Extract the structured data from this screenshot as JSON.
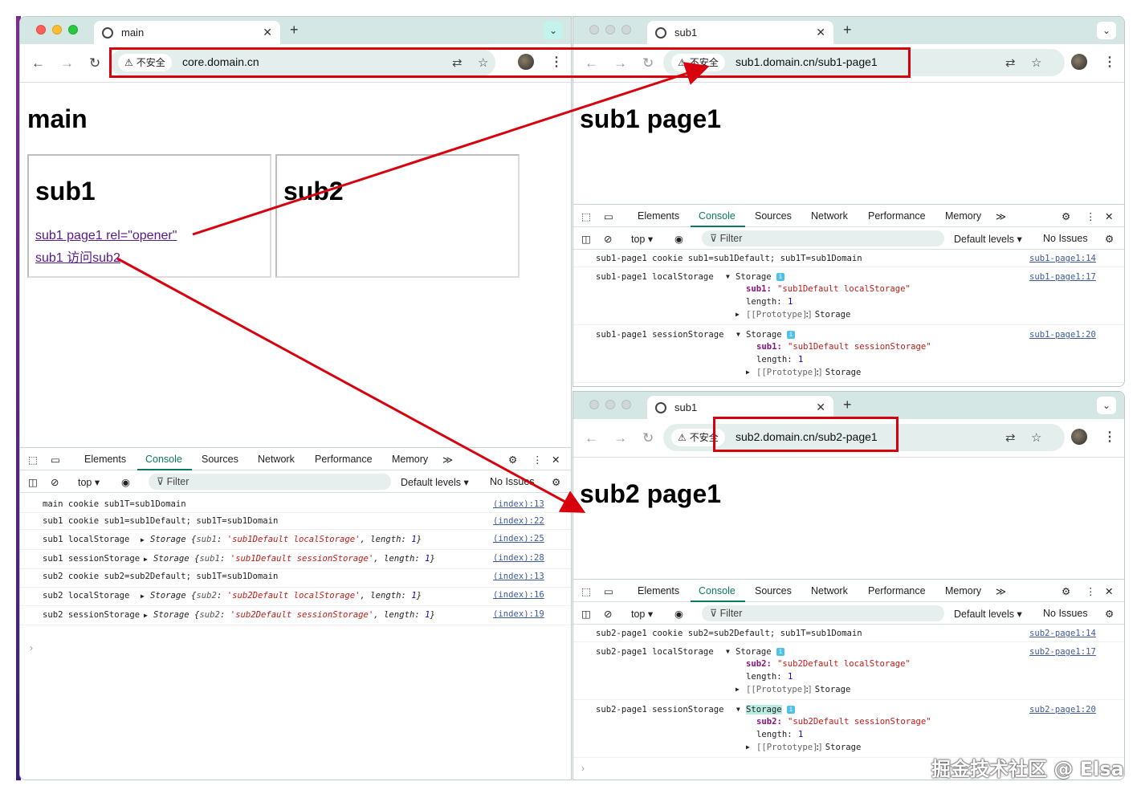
{
  "main": {
    "tab_title": "main",
    "insecure_label": "不安全",
    "url": "core.domain.cn",
    "heading": "main",
    "frame1": {
      "heading": "sub1",
      "link1": "sub1 page1 rel=\"opener\"",
      "link2": "sub1 访问sub2"
    },
    "frame2": {
      "heading": "sub2"
    },
    "devtools": {
      "tabs": [
        "Elements",
        "Console",
        "Sources",
        "Network",
        "Performance",
        "Memory"
      ],
      "context": "top",
      "filter": "Filter",
      "levels": "Default levels ▾",
      "issues": "No Issues",
      "logs": [
        {
          "msg": "main cookie sub1T=sub1Domain",
          "src": "(index):13"
        },
        {
          "msg": "sub1 cookie sub1=sub1Default; sub1T=sub1Domain",
          "src": "(index):22"
        },
        {
          "prefix": "sub1 localStorage",
          "obj": "Storage",
          "k": "sub1",
          "v": "'sub1Default localStorage'",
          "len": "1",
          "src": "(index):25"
        },
        {
          "prefix": "sub1 sessionStorage",
          "obj": "Storage",
          "k": "sub1",
          "v": "'sub1Default sessionStorage'",
          "len": "1",
          "src": "(index):28"
        },
        {
          "msg": "sub2 cookie sub2=sub2Default; sub1T=sub1Domain",
          "src": "(index):13"
        },
        {
          "prefix": "sub2 localStorage",
          "obj": "Storage",
          "k": "sub2",
          "v": "'sub2Default localStorage'",
          "len": "1",
          "src": "(index):16"
        },
        {
          "prefix": "sub2 sessionStorage",
          "obj": "Storage",
          "k": "sub2",
          "v": "'sub2Default sessionStorage'",
          "len": "1",
          "src": "(index):19"
        }
      ]
    }
  },
  "sub1": {
    "tab_title": "sub1",
    "insecure_label": "不安全",
    "url": "sub1.domain.cn/sub1-page1",
    "heading": "sub1 page1",
    "devtools": {
      "tabs": [
        "Elements",
        "Console",
        "Sources",
        "Network",
        "Performance",
        "Memory"
      ],
      "context": "top",
      "filter": "Filter",
      "levels": "Default levels ▾",
      "issues": "No Issues",
      "cookie_log": "sub1-page1 cookie sub1=sub1Default; sub1T=sub1Domain",
      "cookie_src": "sub1-page1:14",
      "local_prefix": "sub1-page1 localStorage",
      "local_src": "sub1-page1:17",
      "session_prefix": "sub1-page1 sessionStorage",
      "session_src": "sub1-page1:20",
      "storage": "Storage",
      "key": "sub1:",
      "local_val": "\"sub1Default localStorage\"",
      "session_val": "\"sub1Default sessionStorage\"",
      "length_label": "length:",
      "length_val": "1",
      "proto": "[[Prototype]]",
      "proto_val": ": Storage"
    }
  },
  "sub2": {
    "tab_title": "sub1",
    "insecure_label": "不安全",
    "url": "sub2.domain.cn/sub2-page1",
    "heading": "sub2 page1",
    "devtools": {
      "tabs": [
        "Elements",
        "Console",
        "Sources",
        "Network",
        "Performance",
        "Memory"
      ],
      "context": "top",
      "filter": "Filter",
      "levels": "Default levels ▾",
      "issues": "No Issues",
      "cookie_log": "sub2-page1 cookie sub2=sub2Default; sub1T=sub1Domain",
      "cookie_src": "sub2-page1:14",
      "local_prefix": "sub2-page1 localStorage",
      "local_src": "sub2-page1:17",
      "session_prefix": "sub2-page1 sessionStorage",
      "session_src": "sub2-page1:20",
      "storage": "Storage",
      "key": "sub2:",
      "local_val": "\"sub2Default localStorage\"",
      "session_val": "\"sub2Default sessionStorage\"",
      "length_label": "length:",
      "length_val": "1",
      "proto": "[[Prototype]]",
      "proto_val": ": Storage"
    }
  },
  "watermark": "掘金技术社区 @ Elsa",
  "colors": {
    "annotation": "#d9000d",
    "accent": "#0a7b62",
    "tabbar": "#d5e7e4"
  }
}
